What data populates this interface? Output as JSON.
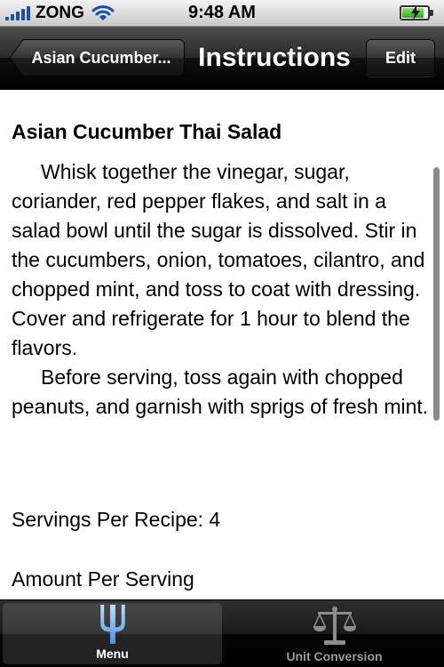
{
  "status_bar": {
    "carrier": "ZONG",
    "time": "9:48 AM",
    "battery_level": 0.85
  },
  "nav_bar": {
    "back_label": "Asian Cucumber...",
    "title": "Instructions",
    "edit_label": "Edit"
  },
  "recipe": {
    "title": "Asian Cucumber Thai Salad",
    "paragraphs": [
      "Whisk together the vinegar, sugar, coriander, red pepper flakes, and salt in a salad bowl until the sugar is dissolved. Stir in the cucumbers, onion, tomatoes, cilantro, and chopped mint, and toss to coat with dressing. Cover and refrigerate for 1 hour to blend the flavors.",
      "Before serving, toss again with chopped peanuts, and garnish with sprigs of fresh mint."
    ],
    "servings": "Servings Per Recipe: 4",
    "amount": "Amount Per Serving"
  },
  "tab_bar": {
    "tabs": [
      {
        "label": "Menu",
        "icon": "fork-icon",
        "selected": true
      },
      {
        "label": "Unit Conversion",
        "icon": "scale-icon",
        "selected": false
      }
    ]
  },
  "colors": {
    "signal": "#1a4fa3",
    "menu_icon": "#7fb6f0",
    "scale_icon": "#8c8c8c"
  }
}
